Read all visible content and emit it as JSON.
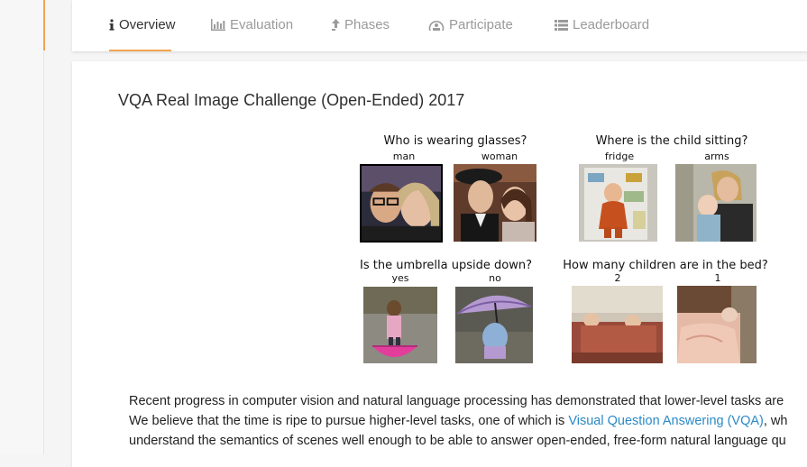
{
  "tabs": [
    {
      "label": "Overview",
      "icon": "info-icon",
      "active": true
    },
    {
      "label": "Evaluation",
      "icon": "bar-chart-icon",
      "active": false
    },
    {
      "label": "Phases",
      "icon": "upload-arrow-icon",
      "active": false
    },
    {
      "label": "Participate",
      "icon": "participate-icon",
      "active": false
    },
    {
      "label": "Leaderboard",
      "icon": "list-icon",
      "active": false
    }
  ],
  "page": {
    "title": "VQA Real Image Challenge (Open-Ended) 2017"
  },
  "figure": {
    "questions": [
      {
        "text": "Who is wearing glasses?",
        "answers": [
          "man",
          "woman"
        ]
      },
      {
        "text": "Where is the child sitting?",
        "answers": [
          "fridge",
          "arms"
        ]
      },
      {
        "text": "Is the umbrella upside down?",
        "answers": [
          "yes",
          "no"
        ]
      },
      {
        "text": "How many children are in the bed?",
        "answers": [
          "2",
          "1"
        ]
      }
    ]
  },
  "paragraph": {
    "line1": "Recent progress in computer vision and natural language processing has demonstrated that lower-level tasks are",
    "line2_pre": "We believe that the time is ripe to pursue higher-level tasks, one of which is ",
    "line2_link": "Visual Question Answering (VQA)",
    "line2_post": ", wh",
    "line3": "understand the semantics of scenes well enough to be able to answer open-ended, free-form natural language qu"
  },
  "colors": {
    "accent": "#f3a451",
    "link": "#2a8ac7"
  }
}
